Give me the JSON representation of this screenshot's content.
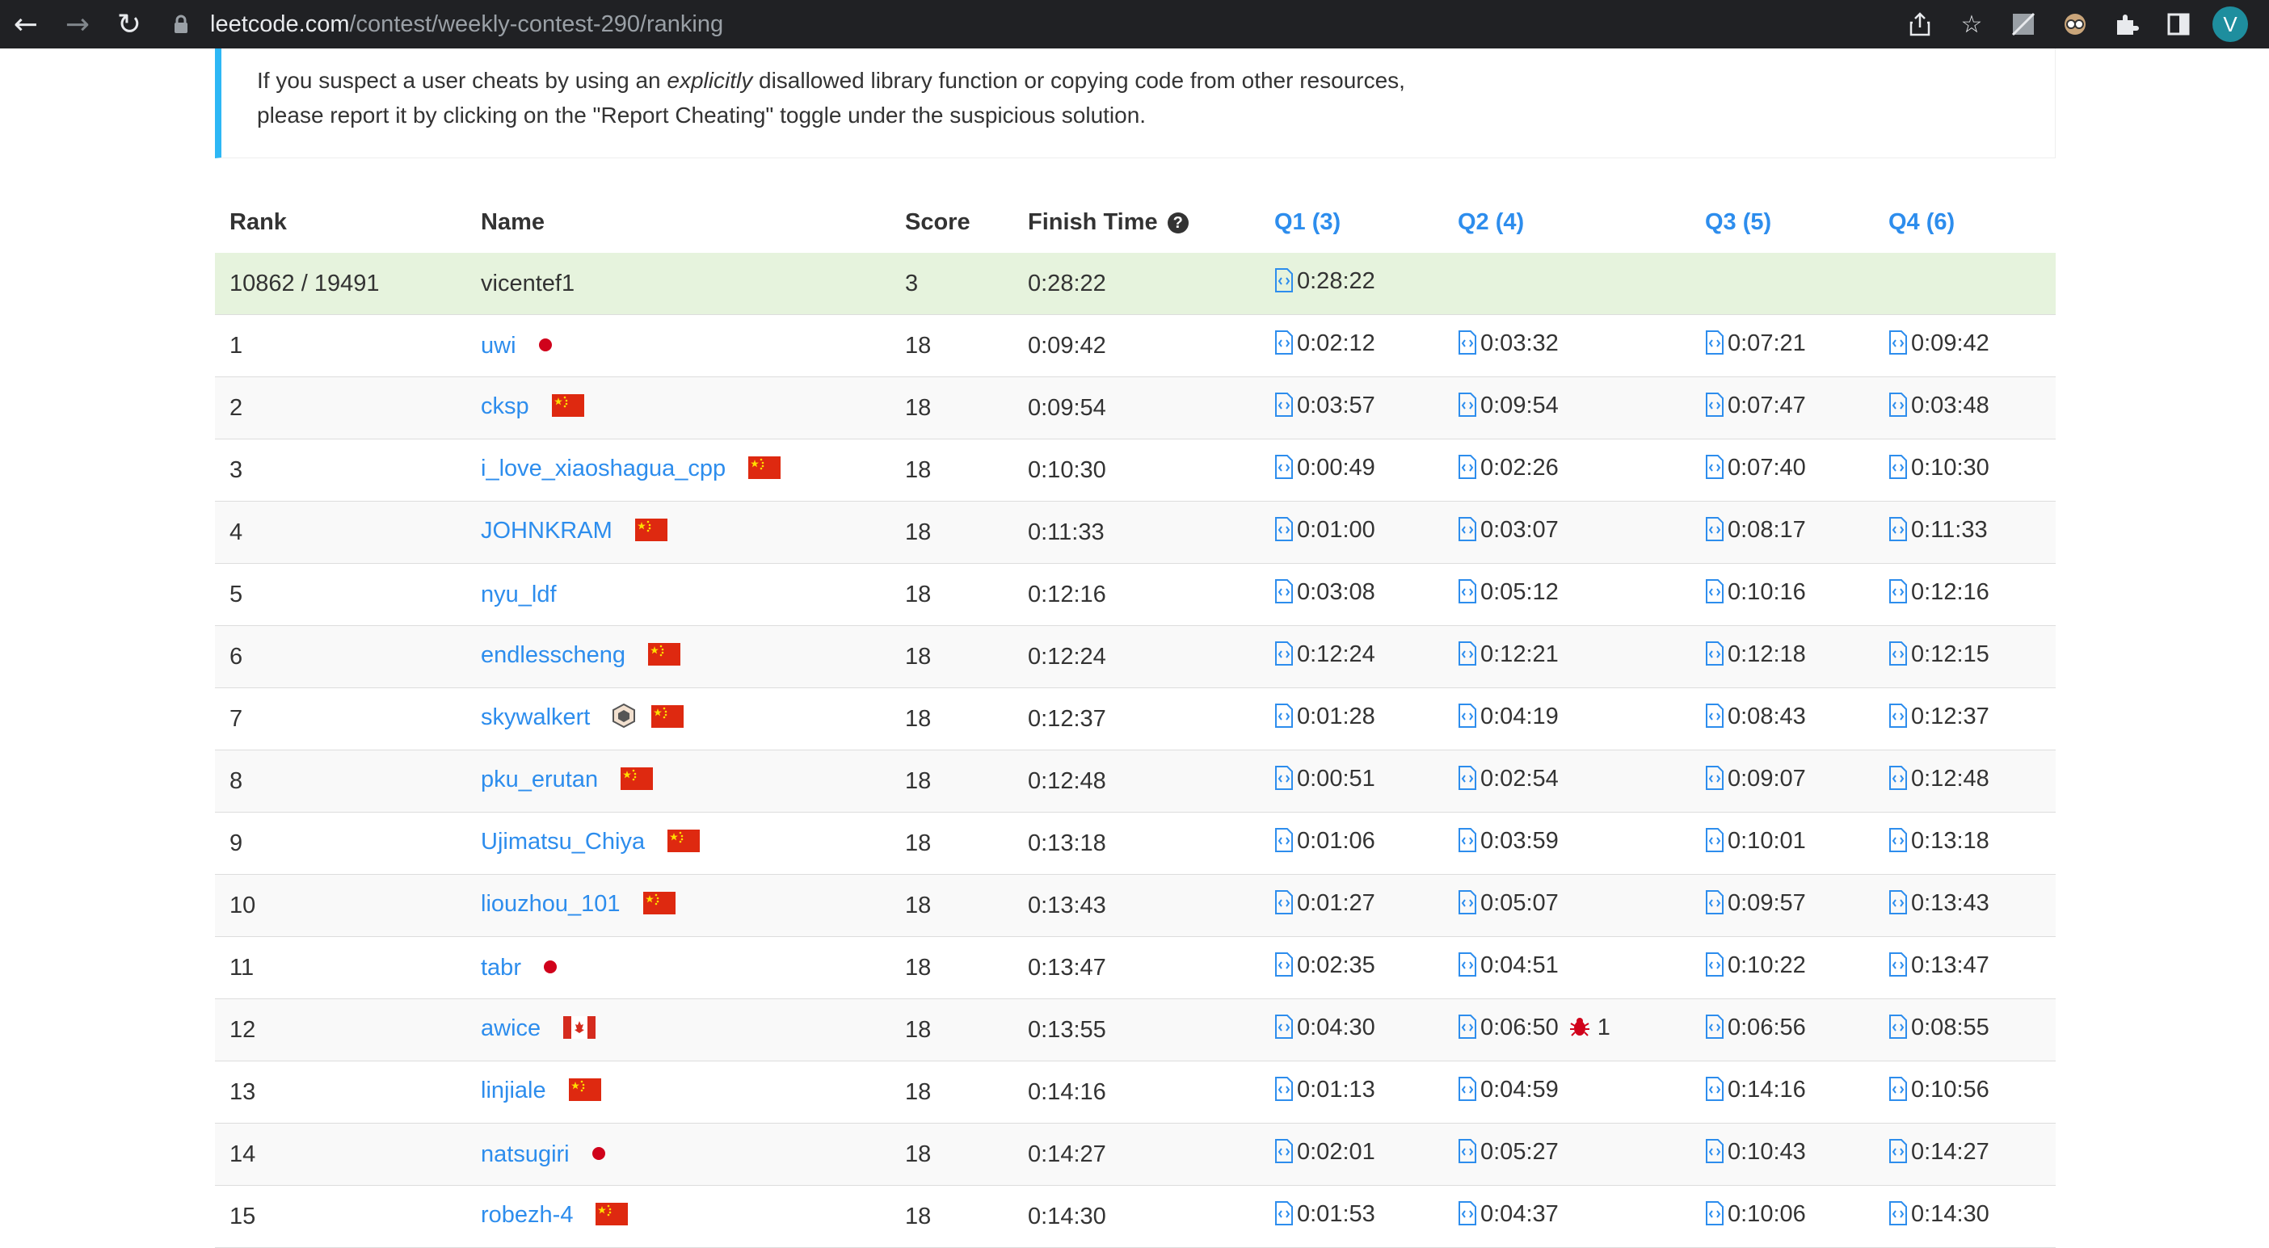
{
  "browser": {
    "url_host": "leetcode.com",
    "url_path": "/contest/weekly-contest-290/ranking",
    "profile_initial": "V"
  },
  "notice": {
    "line1_before": "If you suspect a user cheats by using an ",
    "line1_em": "explicitly",
    "line1_after": " disallowed library function or copying code from other resources,",
    "line2": "please report it by clicking on the \"Report Cheating\" toggle under the suspicious solution."
  },
  "table": {
    "headers": {
      "rank": "Rank",
      "name": "Name",
      "score": "Score",
      "finish": "Finish Time",
      "q1": "Q1 (3)",
      "q2": "Q2 (4)",
      "q3": "Q3 (5)",
      "q4": "Q4 (6)"
    },
    "my_row": {
      "rank": "10862 / 19491",
      "name": "vicentef1",
      "score": "3",
      "finish": "0:28:22",
      "q1": "0:28:22"
    },
    "rows": [
      {
        "rank": "1",
        "name": "uwi",
        "score": "18",
        "finish": "0:09:42",
        "q1": "0:02:12",
        "q2": "0:03:32",
        "q3": "0:07:21",
        "q4": "0:09:42",
        "marker": "dot"
      },
      {
        "rank": "2",
        "name": "cksp",
        "score": "18",
        "finish": "0:09:54",
        "q1": "0:03:57",
        "q2": "0:09:54",
        "q3": "0:07:47",
        "q4": "0:03:48",
        "marker": "cn"
      },
      {
        "rank": "3",
        "name": "i_love_xiaoshagua_cpp",
        "score": "18",
        "finish": "0:10:30",
        "q1": "0:00:49",
        "q2": "0:02:26",
        "q3": "0:07:40",
        "q4": "0:10:30",
        "marker": "cn"
      },
      {
        "rank": "4",
        "name": "JOHNKRAM",
        "score": "18",
        "finish": "0:11:33",
        "q1": "0:01:00",
        "q2": "0:03:07",
        "q3": "0:08:17",
        "q4": "0:11:33",
        "marker": "cn"
      },
      {
        "rank": "5",
        "name": "nyu_ldf",
        "score": "18",
        "finish": "0:12:16",
        "q1": "0:03:08",
        "q2": "0:05:12",
        "q3": "0:10:16",
        "q4": "0:12:16",
        "marker": ""
      },
      {
        "rank": "6",
        "name": "endlesscheng",
        "score": "18",
        "finish": "0:12:24",
        "q1": "0:12:24",
        "q2": "0:12:21",
        "q3": "0:12:18",
        "q4": "0:12:15",
        "marker": "cn"
      },
      {
        "rank": "7",
        "name": "skywalkert",
        "score": "18",
        "finish": "0:12:37",
        "q1": "0:01:28",
        "q2": "0:04:19",
        "q3": "0:08:43",
        "q4": "0:12:37",
        "marker": "badge-cn"
      },
      {
        "rank": "8",
        "name": "pku_erutan",
        "score": "18",
        "finish": "0:12:48",
        "q1": "0:00:51",
        "q2": "0:02:54",
        "q3": "0:09:07",
        "q4": "0:12:48",
        "marker": "cn"
      },
      {
        "rank": "9",
        "name": "Ujimatsu_Chiya",
        "score": "18",
        "finish": "0:13:18",
        "q1": "0:01:06",
        "q2": "0:03:59",
        "q3": "0:10:01",
        "q4": "0:13:18",
        "marker": "cn"
      },
      {
        "rank": "10",
        "name": "liouzhou_101",
        "score": "18",
        "finish": "0:13:43",
        "q1": "0:01:27",
        "q2": "0:05:07",
        "q3": "0:09:57",
        "q4": "0:13:43",
        "marker": "cn"
      },
      {
        "rank": "11",
        "name": "tabr",
        "score": "18",
        "finish": "0:13:47",
        "q1": "0:02:35",
        "q2": "0:04:51",
        "q3": "0:10:22",
        "q4": "0:13:47",
        "marker": "dot"
      },
      {
        "rank": "12",
        "name": "awice",
        "score": "18",
        "finish": "0:13:55",
        "q1": "0:04:30",
        "q2": "0:06:50",
        "q2_penalty": "1",
        "q3": "0:06:56",
        "q4": "0:08:55",
        "marker": "ca"
      },
      {
        "rank": "13",
        "name": "linjiale",
        "score": "18",
        "finish": "0:14:16",
        "q1": "0:01:13",
        "q2": "0:04:59",
        "q3": "0:14:16",
        "q4": "0:10:56",
        "marker": "cn"
      },
      {
        "rank": "14",
        "name": "natsugiri",
        "score": "18",
        "finish": "0:14:27",
        "q1": "0:02:01",
        "q2": "0:05:27",
        "q3": "0:10:43",
        "q4": "0:14:27",
        "marker": "dot"
      },
      {
        "rank": "15",
        "name": "robezh-4",
        "score": "18",
        "finish": "0:14:30",
        "q1": "0:01:53",
        "q2": "0:04:37",
        "q3": "0:10:06",
        "q4": "0:14:30",
        "marker": "cn"
      }
    ]
  }
}
